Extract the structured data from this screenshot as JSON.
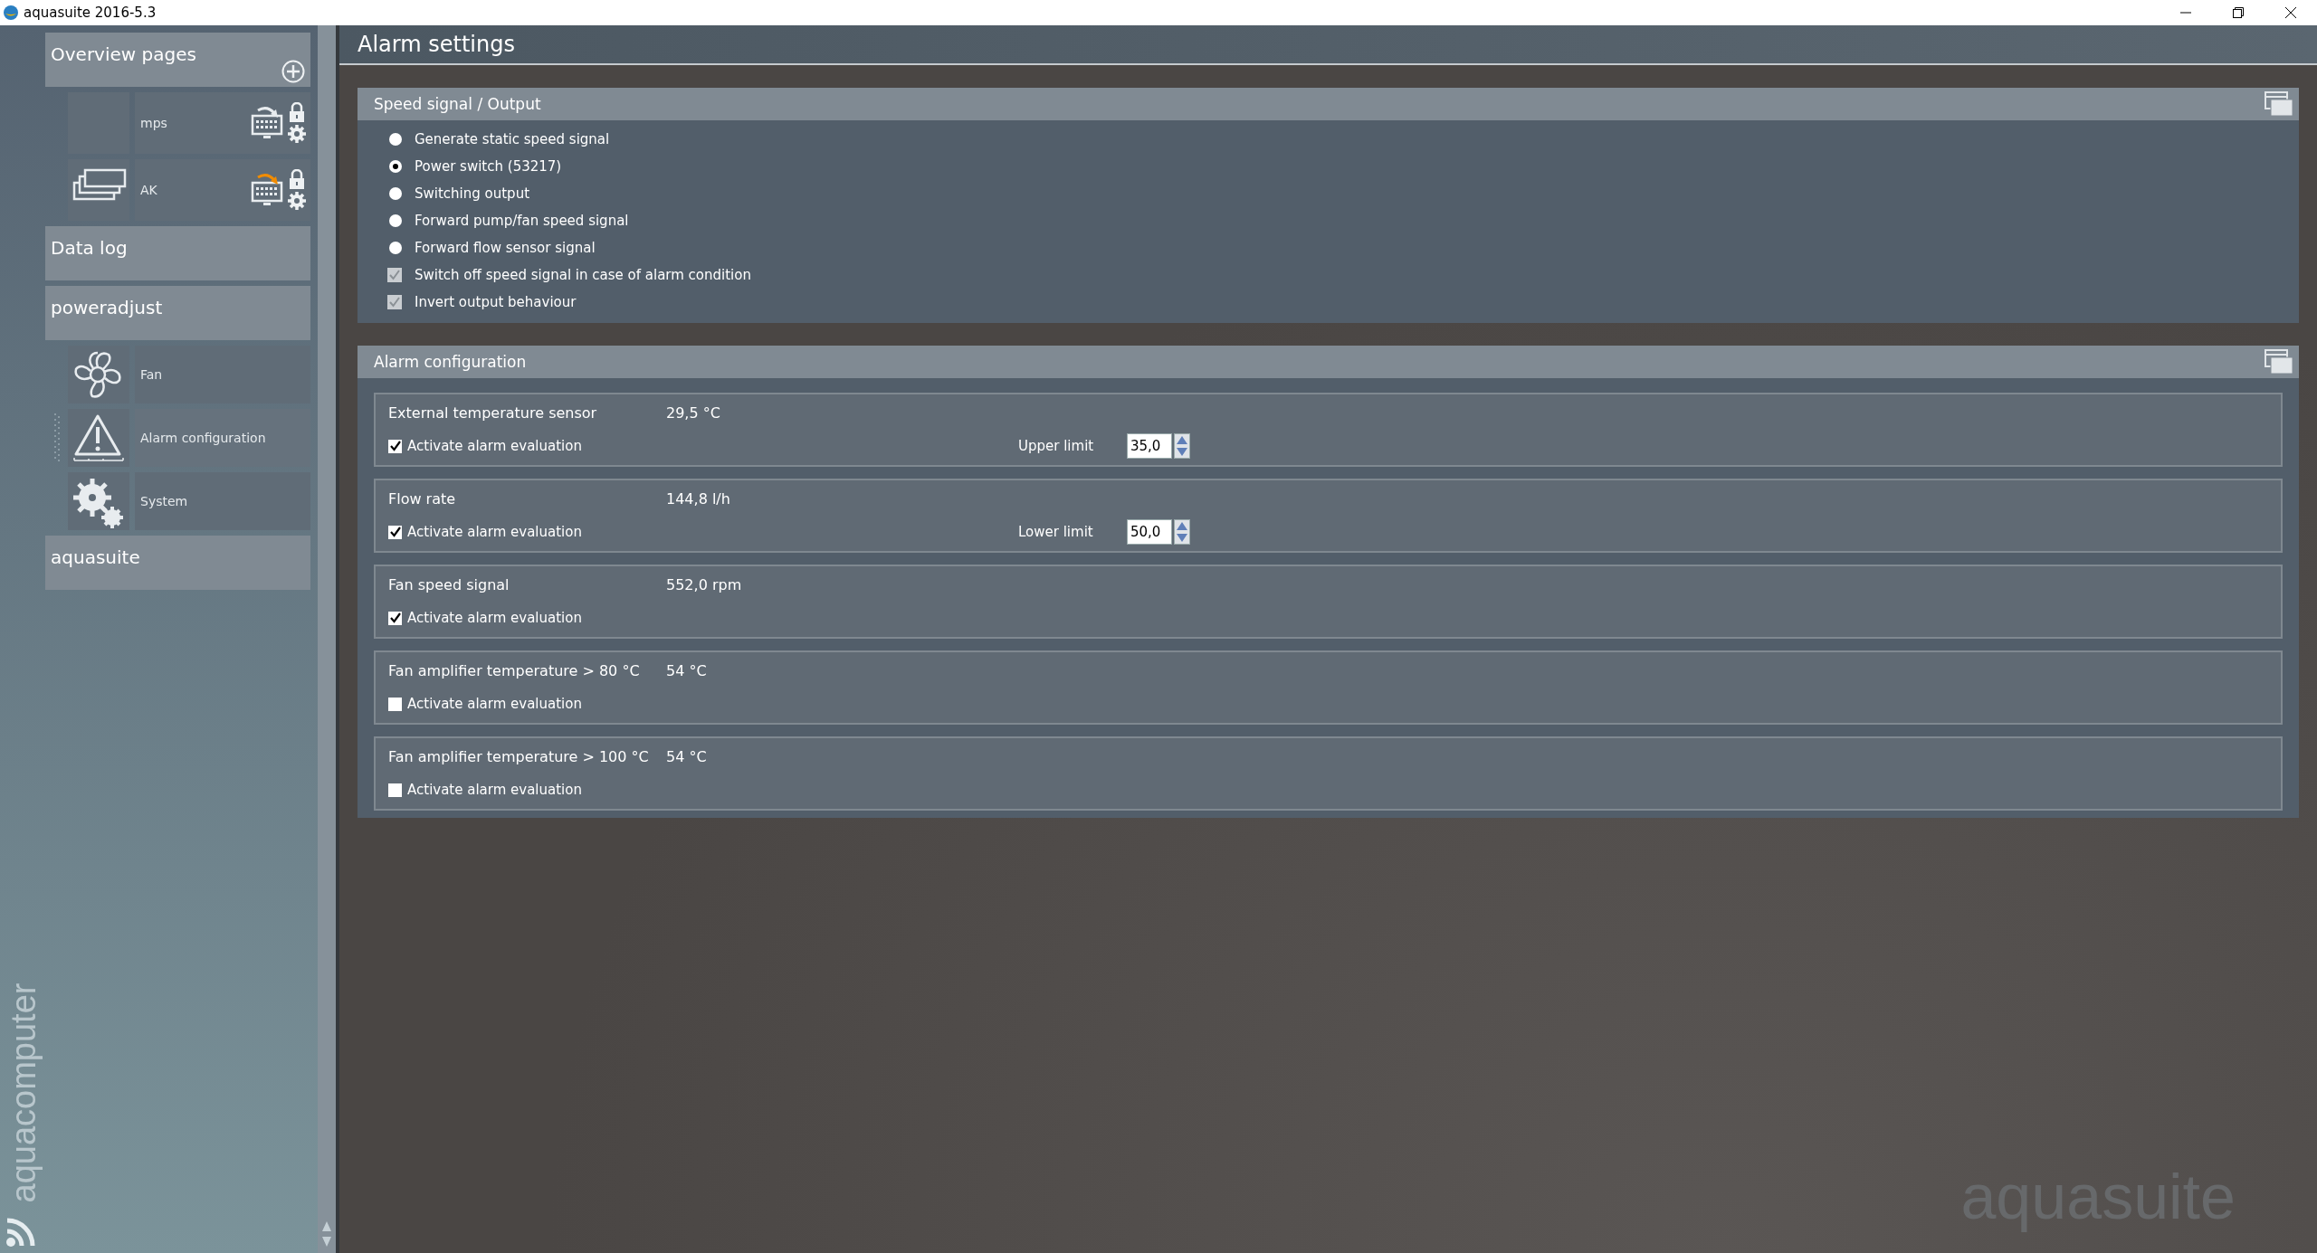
{
  "window": {
    "title": "aquasuite 2016-5.3"
  },
  "sidebar": {
    "sections": [
      {
        "label": "Overview pages",
        "kind": "overview",
        "items": [
          {
            "label": "mps",
            "active": false
          },
          {
            "label": "AK",
            "active": true
          }
        ]
      },
      {
        "label": "Data log",
        "kind": "plain"
      },
      {
        "label": "poweradjust",
        "kind": "device",
        "items": [
          {
            "label": "Fan",
            "selected": false
          },
          {
            "label": "Alarm configuration",
            "selected": true
          },
          {
            "label": "System",
            "selected": false
          }
        ]
      },
      {
        "label": "aquasuite",
        "kind": "plain"
      }
    ],
    "brand": "aquacomputer"
  },
  "page_title": "Alarm settings",
  "speed_panel": {
    "title": "Speed signal / Output",
    "options": [
      {
        "kind": "radio",
        "label": "Generate static speed signal",
        "selected": false
      },
      {
        "kind": "radio",
        "label": "Power switch (53217)",
        "selected": true
      },
      {
        "kind": "radio",
        "label": "Switching output",
        "selected": false
      },
      {
        "kind": "radio",
        "label": "Forward pump/fan speed signal",
        "selected": false
      },
      {
        "kind": "radio",
        "label": "Forward flow sensor signal",
        "selected": false
      },
      {
        "kind": "checkbox",
        "label": "Switch off speed signal in case of alarm condition",
        "checked": true
      },
      {
        "kind": "checkbox",
        "label": "Invert output behaviour",
        "checked": true
      }
    ]
  },
  "alarm_panel": {
    "title": "Alarm configuration",
    "rows": [
      {
        "label": "External temperature sensor",
        "reading": "29,5 °C",
        "evaluation": {
          "label": "Activate alarm evaluation",
          "checked": true
        },
        "limit": {
          "label": "Upper limit",
          "value": "35,0"
        }
      },
      {
        "label": "Flow rate",
        "reading": "144,8 l/h",
        "evaluation": {
          "label": "Activate alarm evaluation",
          "checked": true
        },
        "limit": {
          "label": "Lower limit",
          "value": "50,0"
        }
      },
      {
        "label": "Fan speed signal",
        "reading": "552,0 rpm",
        "evaluation": {
          "label": "Activate alarm evaluation",
          "checked": true
        }
      },
      {
        "label": "Fan amplifier temperature > 80 °C",
        "reading": "54 °C",
        "evaluation": {
          "label": "Activate alarm evaluation",
          "checked": false
        }
      },
      {
        "label": "Fan amplifier temperature > 100 °C",
        "reading": "54 °C",
        "evaluation": {
          "label": "Activate alarm evaluation",
          "checked": false
        }
      }
    ]
  },
  "watermark_logo": "aquasuite"
}
